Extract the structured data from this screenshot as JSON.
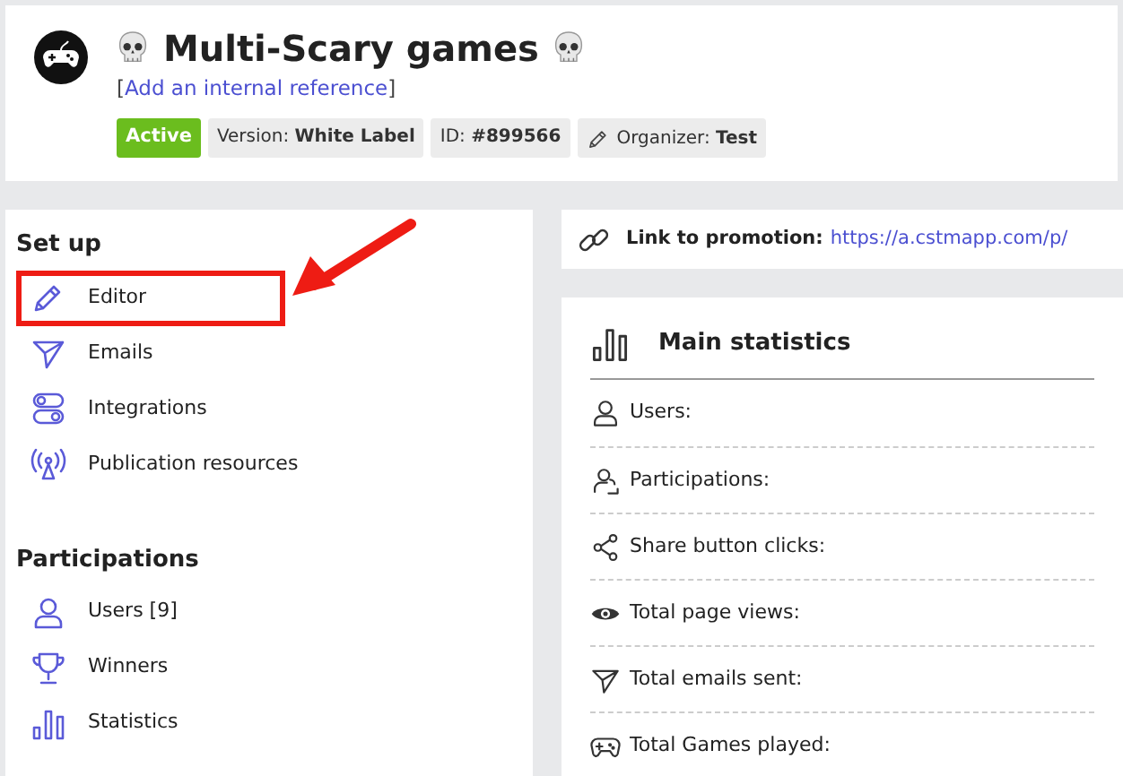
{
  "header": {
    "title": "Multi-Scary games",
    "reference_link": "Add an internal reference",
    "bracket_open": "[",
    "bracket_close": "]",
    "badges": [
      {
        "kind": "status",
        "text": "Active"
      },
      {
        "kind": "info",
        "text": "Version: **White Label**"
      },
      {
        "kind": "info",
        "text": "ID: **#899566**"
      },
      {
        "kind": "organizer",
        "text": "Organizer: **Test**"
      }
    ]
  },
  "sidebar": {
    "sections": [
      {
        "title": "Set up",
        "items": [
          {
            "label": "Editor",
            "kind": "pencil",
            "highlighted": true
          },
          {
            "label": "Emails",
            "kind": "send",
            "highlighted": false
          },
          {
            "label": "Integrations",
            "kind": "toggles",
            "highlighted": false
          },
          {
            "label": "Publication resources",
            "kind": "antenna",
            "highlighted": false
          }
        ]
      },
      {
        "title": "Participations",
        "items": [
          {
            "label": "Users [9]",
            "kind": "user",
            "highlighted": false
          },
          {
            "label": "Winners",
            "kind": "trophy",
            "highlighted": false
          },
          {
            "label": "Statistics",
            "kind": "bars",
            "highlighted": false
          }
        ]
      }
    ]
  },
  "promotion": {
    "label": "Link to promotion:",
    "url": "https://a.cstmapp.com/p/"
  },
  "statistics": {
    "title": "Main statistics",
    "rows": [
      {
        "label": "Users:",
        "kind": "user"
      },
      {
        "label": "Participations:",
        "kind": "users"
      },
      {
        "label": "Share button clicks:",
        "kind": "share"
      },
      {
        "label": "Total page views:",
        "kind": "eye"
      },
      {
        "label": "Total emails sent:",
        "kind": "send"
      },
      {
        "label": "Total Games played:",
        "kind": "gamepad"
      }
    ]
  }
}
